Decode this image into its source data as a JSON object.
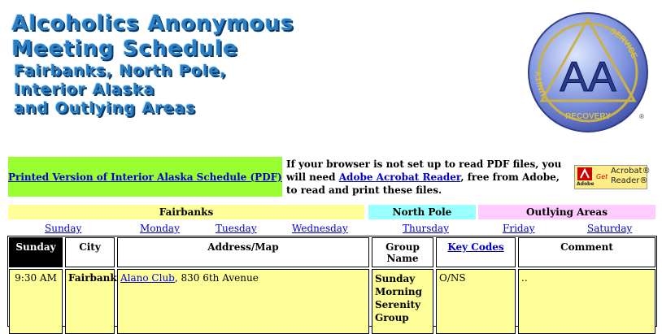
{
  "header": {
    "title_lines": [
      "Alcoholics Anonymous",
      "Meeting Schedule"
    ],
    "subtitle_lines": [
      "Fairbanks, North Pole,",
      "Interior Alaska",
      "and Outlying Areas"
    ]
  },
  "logo": {
    "letters": "AA",
    "words": [
      "UNITY",
      "SERVICE",
      "RECOVERY"
    ],
    "registered": "®"
  },
  "pdf": {
    "link_label": "Printed Version of Interior Alaska Schedule (PDF)",
    "notice_before": "If your browser is not set up to read PDF files, you will need ",
    "reader_link": "Adobe Acrobat Reader",
    "notice_after": ", free from Adobe, to read and print these files.",
    "badge": {
      "get": "Get",
      "product_line1": "Acrobat®",
      "product_line2": "Reader®",
      "brand": "Adobe"
    }
  },
  "regions": [
    {
      "label": "Fairbanks",
      "color": "#ffff99"
    },
    {
      "label": "North Pole",
      "color": "#99ffff"
    },
    {
      "label": "Outlying Areas",
      "color": "#ffccff"
    }
  ],
  "days": [
    "Sunday",
    "Monday",
    "Tuesday",
    "Wednesday",
    "Thursday",
    "Friday",
    "Saturday"
  ],
  "table": {
    "headers": {
      "day": "Sunday",
      "city": "City",
      "address": "Address/Map",
      "group": "Group Name",
      "codes": "Key Codes",
      "comment": "Comment"
    },
    "rows": [
      {
        "time": "9:30 AM",
        "city": "Fairbanks",
        "address_link": "Alano Club",
        "address_rest": ", 830 6th Avenue",
        "group": "Sunday Morning Serenity Group",
        "codes": "O/NS",
        "comment": ".."
      }
    ]
  }
}
